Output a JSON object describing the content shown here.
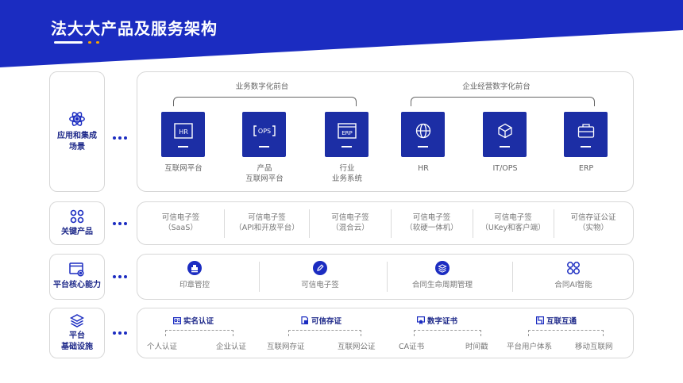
{
  "page": {
    "title": "法大大产品及服务架构",
    "colors": {
      "primary": "#1b2cc1",
      "accent": "#f7a400",
      "text": "#555555"
    }
  },
  "layers": [
    {
      "label": "应用和集成\n场景",
      "icon": "atom-icon"
    },
    {
      "label": "关键产品",
      "icon": "grid-icon"
    },
    {
      "label": "平台核心能力",
      "icon": "window-gear-icon"
    },
    {
      "label": "平台\n基础设施",
      "icon": "layers-icon"
    }
  ],
  "scenarios": {
    "groups": [
      "业务数字化前台",
      "企业经营数字化前台"
    ],
    "tiles": [
      {
        "icon_text": "HR",
        "icon": "hr-icon",
        "label": "互联网平台"
      },
      {
        "icon_text": "OPS",
        "icon": "ops-icon",
        "label": "产品\n互联网平台"
      },
      {
        "icon_text": "ERP",
        "icon": "erp-icon",
        "label": "行业\n业务系统"
      },
      {
        "icon": "globe-icon",
        "label": "HR"
      },
      {
        "icon": "cube-icon",
        "label": "IT/OPS"
      },
      {
        "icon": "briefcase-icon",
        "label": "ERP"
      }
    ]
  },
  "products": [
    "可信电子签\n（SaaS）",
    "可信电子签\n（API和开放平台）",
    "可信电子签\n（混合云）",
    "可信电子签\n（软硬一体机）",
    "可信电子签\n（UKey和客户端）",
    "可信存证公证\n（实物）"
  ],
  "capabilities": [
    {
      "icon": "stamp-icon",
      "label": "印章管控"
    },
    {
      "icon": "pen-icon",
      "label": "可信电子签"
    },
    {
      "icon": "stack-icon",
      "label": "合同生命周期管理"
    },
    {
      "icon": "ai-grid-icon",
      "label": "合同AI智能"
    }
  ],
  "infrastructure": [
    {
      "icon": "id-card-icon",
      "title": "实名认证",
      "items": [
        "个人认证",
        "企业认证"
      ]
    },
    {
      "icon": "doc-lock-icon",
      "title": "可信存证",
      "items": [
        "互联网存证",
        "互联网公证"
      ]
    },
    {
      "icon": "certificate-icon",
      "title": "数字证书",
      "items": [
        "CA证书",
        "时间戳"
      ]
    },
    {
      "icon": "link-icon",
      "title": "互联互通",
      "items": [
        "平台用户体系",
        "移动互联网"
      ]
    }
  ]
}
